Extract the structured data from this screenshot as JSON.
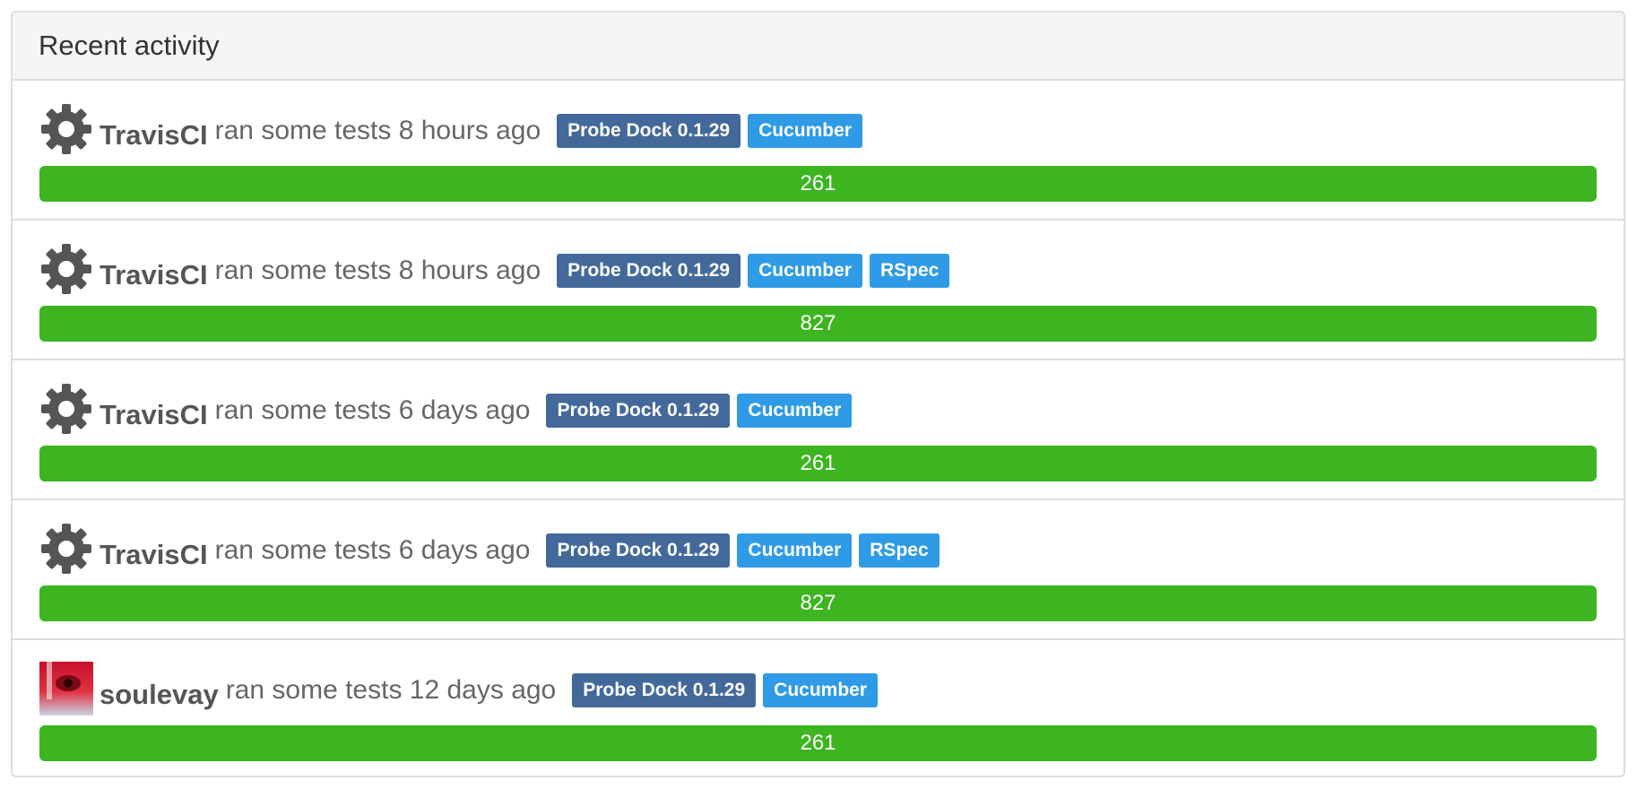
{
  "panel": {
    "title": "Recent activity"
  },
  "colors": {
    "project_tag": "#43699b",
    "category_tag": "#2f9be6",
    "passed_bar": "#3cb521",
    "gear_icon": "#555555"
  },
  "activities": [
    {
      "avatar": "gear-icon",
      "user": "TravisCI",
      "text": "ran some tests 8 hours ago",
      "project_tag": "Probe Dock 0.1.29",
      "categories": [
        "Cucumber"
      ],
      "tests_count": "261",
      "passed_fraction": 1.0
    },
    {
      "avatar": "gear-icon",
      "user": "TravisCI",
      "text": "ran some tests 8 hours ago",
      "project_tag": "Probe Dock 0.1.29",
      "categories": [
        "Cucumber",
        "RSpec"
      ],
      "tests_count": "827",
      "passed_fraction": 1.0
    },
    {
      "avatar": "gear-icon",
      "user": "TravisCI",
      "text": "ran some tests 6 days ago",
      "project_tag": "Probe Dock 0.1.29",
      "categories": [
        "Cucumber"
      ],
      "tests_count": "261",
      "passed_fraction": 1.0
    },
    {
      "avatar": "gear-icon",
      "user": "TravisCI",
      "text": "ran some tests 6 days ago",
      "project_tag": "Probe Dock 0.1.29",
      "categories": [
        "Cucumber",
        "RSpec"
      ],
      "tests_count": "827",
      "passed_fraction": 1.0
    },
    {
      "avatar": "user-photo-avatar",
      "user": "soulevay",
      "text": "ran some tests 12 days ago",
      "project_tag": "Probe Dock 0.1.29",
      "categories": [
        "Cucumber"
      ],
      "tests_count": "261",
      "passed_fraction": 1.0
    }
  ]
}
